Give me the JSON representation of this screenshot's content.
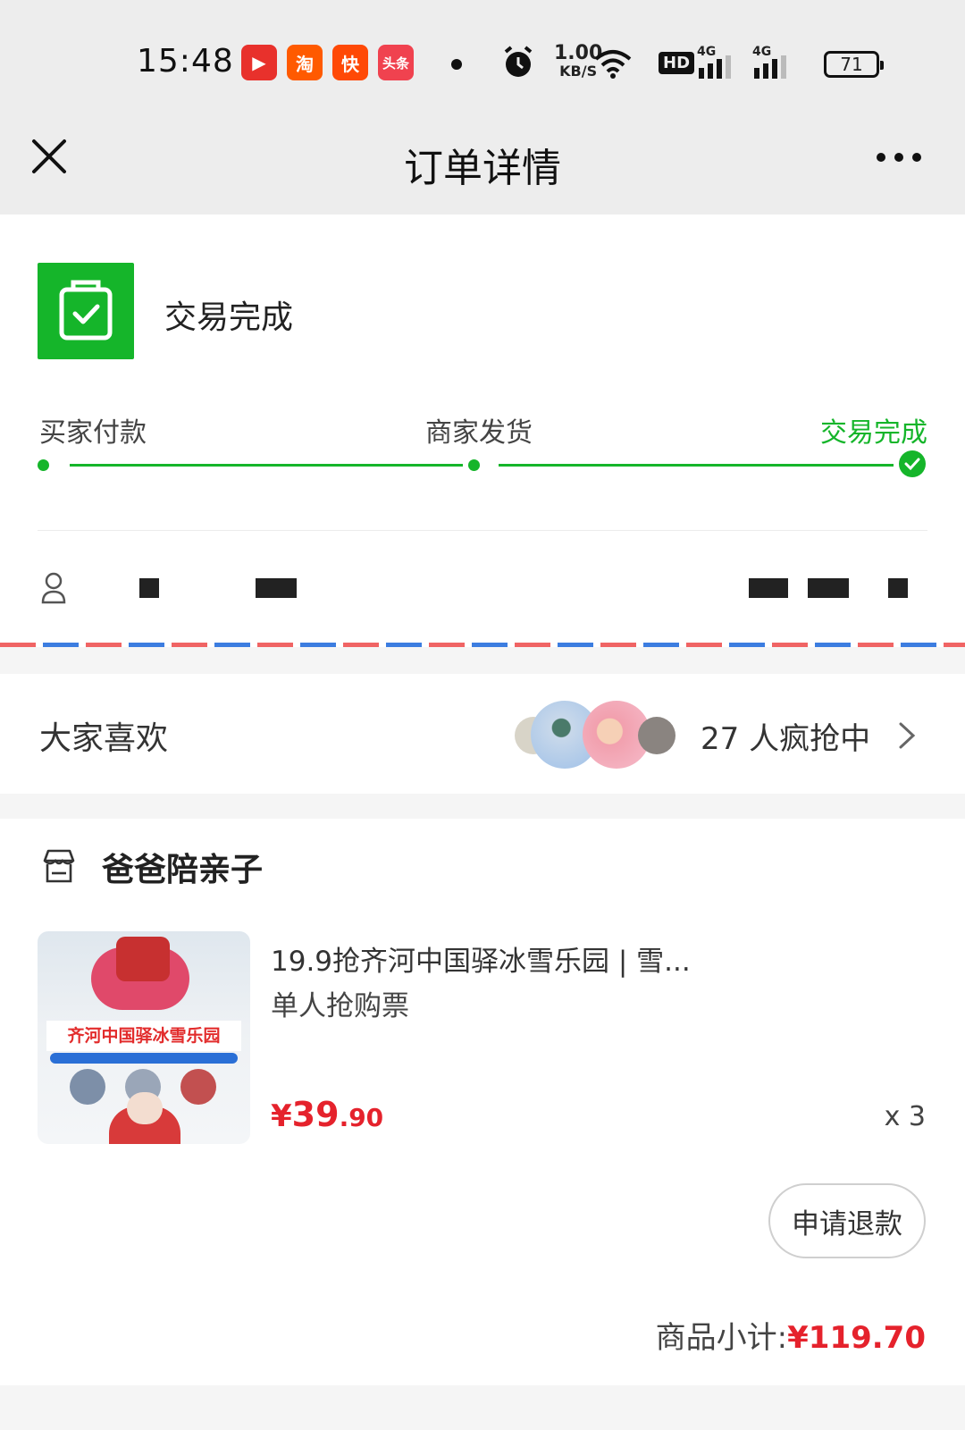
{
  "status_bar": {
    "time": "15:48",
    "apps": [
      {
        "icon": "video-app-icon",
        "glyph": "▶",
        "color": "#e8312c"
      },
      {
        "icon": "taobao-icon",
        "glyph": "淘",
        "color": "#ff5a00"
      },
      {
        "icon": "kuaishou-icon",
        "glyph": "快",
        "color": "#ff4906"
      },
      {
        "icon": "toutiao-icon",
        "glyph": "头条",
        "color": "#f0424f"
      }
    ],
    "net_speed": "1.00",
    "net_unit": "KB/S",
    "hd_label": "HD",
    "signal_1": "4G",
    "signal_2": "4G",
    "battery": "71"
  },
  "nav": {
    "title": "订单详情"
  },
  "order_status": {
    "label": "交易完成",
    "steps": [
      {
        "label": "买家付款",
        "done": true
      },
      {
        "label": "商家发货",
        "done": true
      },
      {
        "label": "交易完成",
        "done": true,
        "active": true
      }
    ]
  },
  "popular": {
    "title": "大家喜欢",
    "count_text": "27 人疯抢中"
  },
  "store": {
    "name": "爸爸陪亲子"
  },
  "product": {
    "title": "19.9抢齐河中国驿冰雪乐园 | 雪...",
    "sku": "单人抢购票",
    "price_symbol": "¥",
    "price_int": "39",
    "price_dec": ".90",
    "quantity": "x 3",
    "image_banner": "齐河中国驿冰雪乐园"
  },
  "actions": {
    "refund_label": "申请退款"
  },
  "summary": {
    "subtotal_label": "商品小计:",
    "subtotal_value": "¥119.70"
  },
  "colors": {
    "brand_green": "#15b52a",
    "price_red": "#e5222c",
    "header_bg": "#ededed"
  }
}
